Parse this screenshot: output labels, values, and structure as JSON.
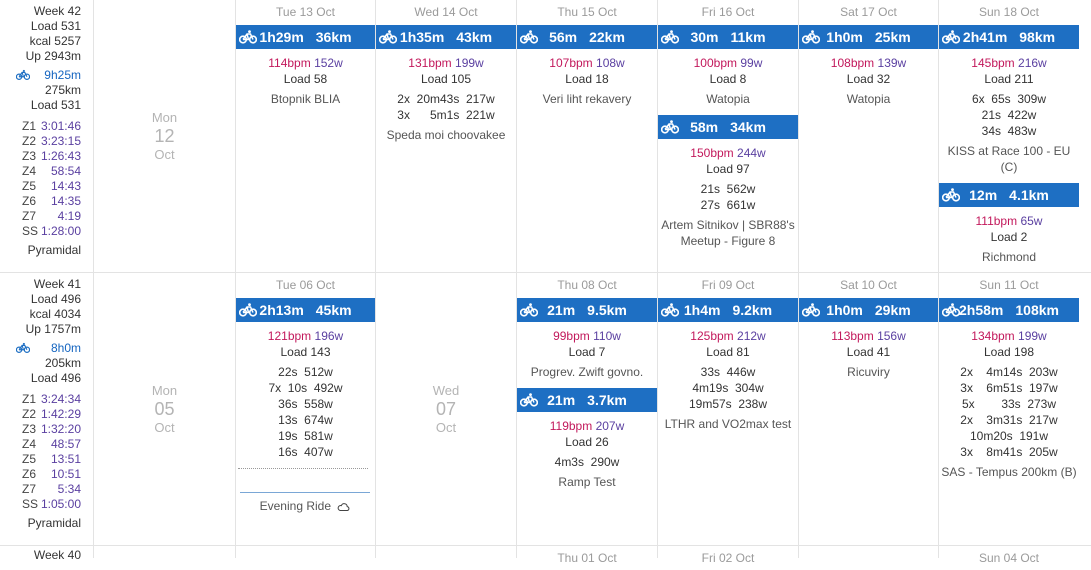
{
  "weeks": [
    {
      "label": "Week",
      "num": "42",
      "load_label": "Load",
      "load": "531",
      "kcal_label": "kcal",
      "kcal": "5257",
      "up_label": "Up",
      "up": "2943m",
      "bike_time": "9h25m",
      "bike_dist": "275km",
      "bike_load_label": "Load",
      "bike_load": "531",
      "zones": [
        [
          "Z1",
          "3:01:46"
        ],
        [
          "Z2",
          "3:23:15"
        ],
        [
          "Z3",
          "1:26:43"
        ],
        [
          "Z4",
          "58:54"
        ],
        [
          "Z5",
          "14:43"
        ],
        [
          "Z6",
          "14:35"
        ],
        [
          "Z7",
          "4:19"
        ],
        [
          "SS",
          "1:28:00"
        ]
      ],
      "style": "Pyramidal",
      "empty_day": {
        "dow": "Mon",
        "num": "12",
        "mon": "Oct"
      }
    },
    {
      "label": "Week",
      "num": "41",
      "load_label": "Load",
      "load": "496",
      "kcal_label": "kcal",
      "kcal": "4034",
      "up_label": "Up",
      "up": "1757m",
      "bike_time": "8h0m",
      "bike_dist": "205km",
      "bike_load_label": "Load",
      "bike_load": "496",
      "zones": [
        [
          "Z1",
          "3:24:34"
        ],
        [
          "Z2",
          "1:42:29"
        ],
        [
          "Z3",
          "1:32:20"
        ],
        [
          "Z4",
          "48:57"
        ],
        [
          "Z5",
          "13:51"
        ],
        [
          "Z6",
          "10:51"
        ],
        [
          "Z7",
          "5:34"
        ],
        [
          "SS",
          "1:05:00"
        ]
      ],
      "style": "Pyramidal",
      "empty_day": {
        "dow": "Mon",
        "num": "05",
        "mon": "Oct"
      },
      "empty_day2": {
        "dow": "Wed",
        "num": "07",
        "mon": "Oct"
      }
    },
    {
      "label": "Week",
      "num": "40"
    }
  ],
  "headers_row1": [
    "Tue 13 Oct",
    "Wed 14 Oct",
    "Thu 15 Oct",
    "Fri 16 Oct",
    "Sat 17 Oct",
    "Sun 18 Oct"
  ],
  "headers_row2": [
    "Tue 06 Oct",
    "Thu 08 Oct",
    "Fri 09 Oct",
    "Sat 10 Oct",
    "Sun 11 Oct"
  ],
  "headers_row3": [
    "Thu 01 Oct",
    "Fri 02 Oct",
    "Sun 04 Oct"
  ],
  "activities": {
    "tue13": {
      "time": "1h29m",
      "dist": "36km",
      "bpm": "114bpm",
      "watts": "152w",
      "load": "Load 58",
      "intervals": [],
      "name": "Btopnik BLIA"
    },
    "wed14": {
      "time": "1h35m",
      "dist": "43km",
      "bpm": "131bpm",
      "watts": "199w",
      "load": "Load 105",
      "intervals": [
        "2x  20m43s  217w",
        "3x      5m1s  221w"
      ],
      "name": "Speda moi choovakee"
    },
    "thu15": {
      "time": "56m",
      "dist": "22km",
      "bpm": "107bpm",
      "watts": "108w",
      "load": "Load 18",
      "intervals": [],
      "name": "Veri liht rekavery"
    },
    "fri16a": {
      "time": "30m",
      "dist": "11km",
      "bpm": "100bpm",
      "watts": "99w",
      "load": "Load 8",
      "intervals": [],
      "name": "Watopia"
    },
    "fri16b": {
      "time": "58m",
      "dist": "34km",
      "bpm": "150bpm",
      "watts": "244w",
      "load": "Load 97",
      "intervals": [
        "21s  562w",
        "27s  661w"
      ],
      "name": "Artem Sitnikov | SBR88's Meetup - Figure 8"
    },
    "sat17": {
      "time": "1h0m",
      "dist": "25km",
      "bpm": "108bpm",
      "watts": "139w",
      "load": "Load 32",
      "intervals": [],
      "name": "Watopia"
    },
    "sun18a": {
      "time": "2h41m",
      "dist": "98km",
      "bpm": "145bpm",
      "watts": "216w",
      "load": "Load 211",
      "intervals": [
        "6x  65s  309w",
        "21s  422w",
        "34s  483w"
      ],
      "name": "KISS at Race 100 - EU (C)"
    },
    "sun18b": {
      "time": "12m",
      "dist": "4.1km",
      "bpm": "111bpm",
      "watts": "65w",
      "load": "Load 2",
      "intervals": [],
      "name": "Richmond"
    },
    "tue06": {
      "time": "2h13m",
      "dist": "45km",
      "bpm": "121bpm",
      "watts": "196w",
      "load": "Load 143",
      "intervals": [
        "22s  512w",
        "7x  10s  492w",
        "36s  558w",
        "13s  674w",
        "19s  581w",
        "16s  407w"
      ],
      "name": ""
    },
    "thu08a": {
      "time": "21m",
      "dist": "9.5km",
      "bpm": "99bpm",
      "watts": "110w",
      "load": "Load 7",
      "intervals": [],
      "name": "Progrev. Zwift govno."
    },
    "thu08b": {
      "time": "21m",
      "dist": "3.7km",
      "bpm": "119bpm",
      "watts": "207w",
      "load": "Load 26",
      "intervals": [
        "4m3s  290w"
      ],
      "name": "Ramp Test"
    },
    "fri09": {
      "time": "1h4m",
      "dist": "9.2km",
      "bpm": "125bpm",
      "watts": "212w",
      "load": "Load 81",
      "intervals": [
        "33s  446w",
        "4m19s  304w",
        "19m57s  238w"
      ],
      "name": "LTHR and VO2max test"
    },
    "sat10": {
      "time": "1h0m",
      "dist": "29km",
      "bpm": "113bpm",
      "watts": "156w",
      "load": "Load 41",
      "intervals": [],
      "name": "Ricuviry"
    },
    "sun11": {
      "time": "2h58m",
      "dist": "108km",
      "bpm": "134bpm",
      "watts": "199w",
      "load": "Load 198",
      "intervals": [
        "2x    4m14s  203w",
        "3x    6m51s  197w",
        "5x        33s  273w",
        "2x    3m31s  217w",
        "10m20s  191w",
        "3x    8m41s  205w"
      ],
      "name": "SAS - Tempus 200km (B)"
    }
  },
  "planned": {
    "name": "Evening Ride",
    "icon": "cloud-icon"
  },
  "colors": {
    "accent": "#1e6fc3",
    "bpm": "#c2185b",
    "watts": "#5a3fa0"
  }
}
